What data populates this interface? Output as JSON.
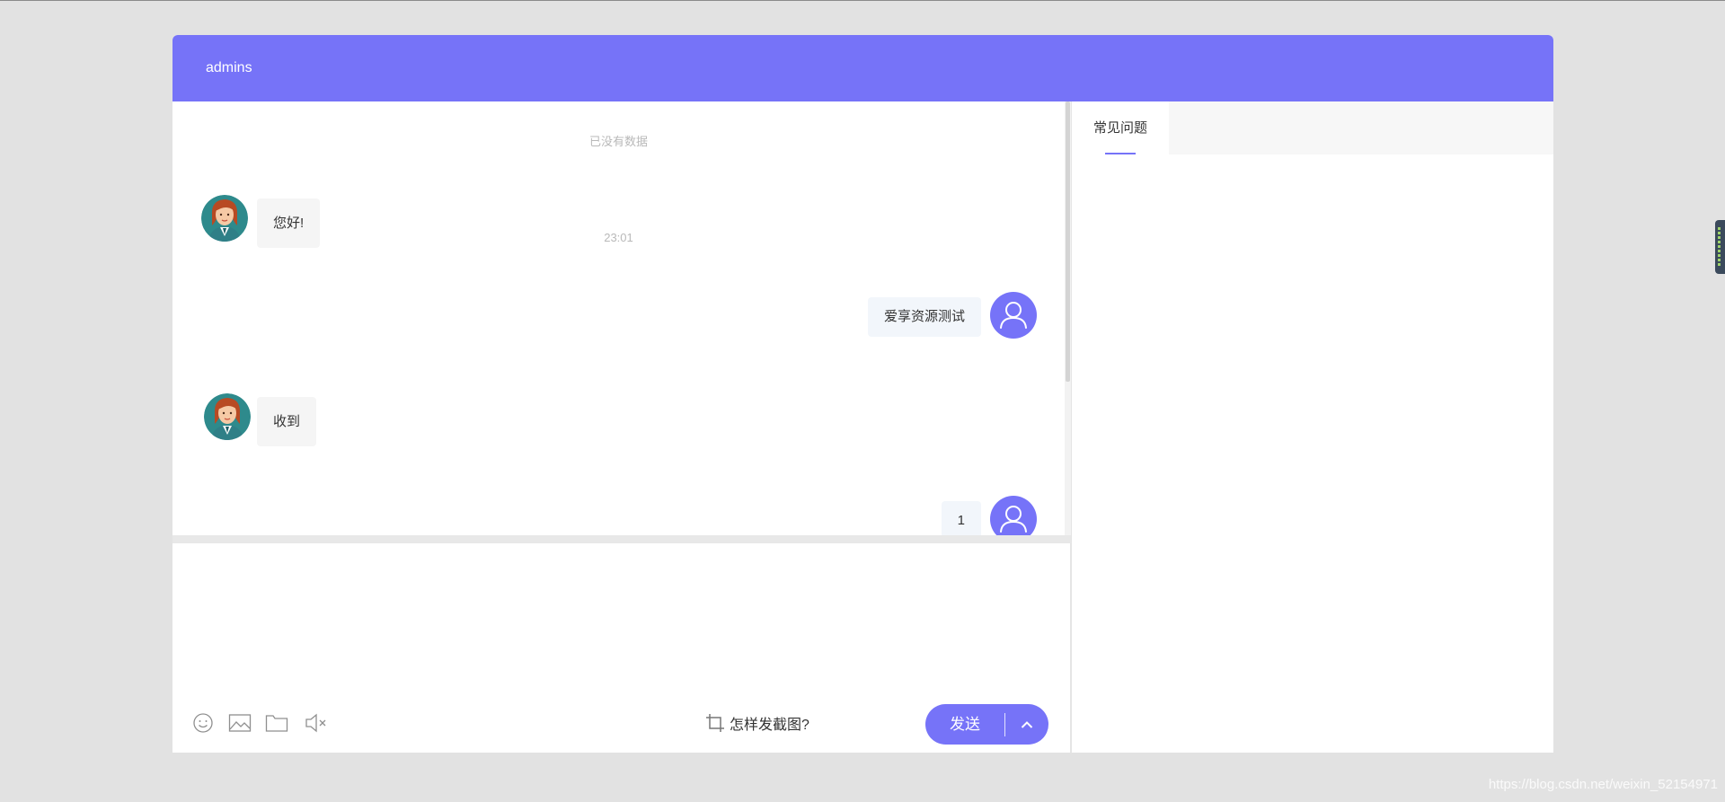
{
  "header": {
    "title": "admins"
  },
  "chat": {
    "no_more_data": "已没有数据",
    "messages": [
      {
        "from": "agent",
        "text": "您好!"
      },
      {
        "from": "time",
        "text": "23:01"
      },
      {
        "from": "user",
        "text": "爱享资源测试"
      },
      {
        "from": "agent",
        "text": "收到"
      },
      {
        "from": "user",
        "text": "1"
      }
    ]
  },
  "composer": {
    "placeholder": "",
    "tools": [
      "emoji-icon",
      "image-icon",
      "folder-icon",
      "sound-off-icon"
    ],
    "screenshot_tip": "怎样发截图?",
    "send_label": "发送"
  },
  "sidebar": {
    "tabs": [
      {
        "label": "常见问题",
        "active": true
      }
    ]
  },
  "watermark": "https://blog.csdn.net/weixin_52154971",
  "colors": {
    "accent": "#7673f8",
    "page_bg": "#e2e2e2",
    "agent_bubble": "#f5f5f5",
    "user_bubble": "#f2f6fb"
  }
}
